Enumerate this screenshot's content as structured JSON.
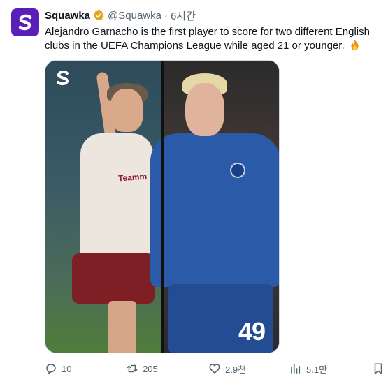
{
  "author": {
    "display_name": "Squawka",
    "handle": "@Squawka",
    "separator": "·",
    "time": "6시간",
    "verified_icon": "verified-badge-icon",
    "brand_color": "#5a1fb8"
  },
  "tweet": {
    "text": "Alejandro Garnacho is the first player to score for two different English clubs in the UEFA Champions League while aged 21 or younger.",
    "emoji_icon": "fire-icon"
  },
  "media": {
    "sponsor_text": "Teamm ewer",
    "shirt_number": "49"
  },
  "actions": {
    "replies": "10",
    "reposts": "205",
    "likes": "2.9천",
    "views": "5.1만"
  }
}
